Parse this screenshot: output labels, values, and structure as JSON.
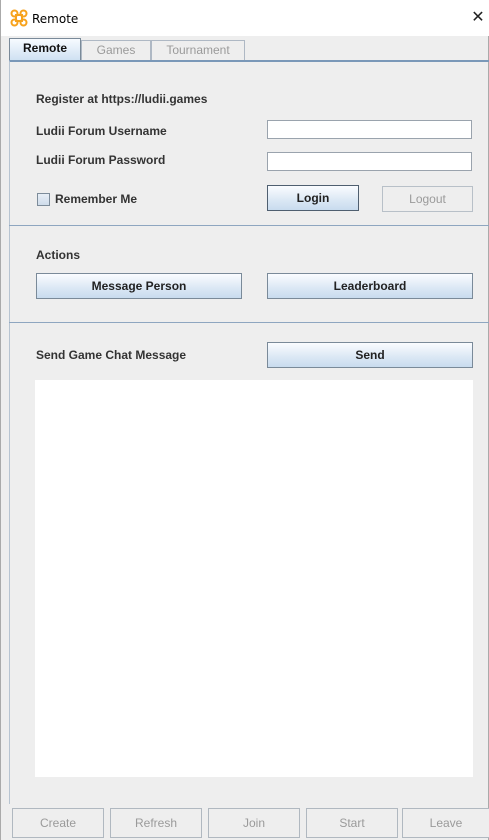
{
  "window": {
    "title": "Remote",
    "close_glyph": "✕"
  },
  "tabs": [
    {
      "label": "Remote",
      "active": true
    },
    {
      "label": "Games",
      "active": false
    },
    {
      "label": "Tournament",
      "active": false
    }
  ],
  "login": {
    "register_text": "Register at https://ludii.games",
    "username_label": "Ludii Forum Username",
    "username_value": "",
    "password_label": "Ludii Forum Password",
    "password_value": "",
    "remember_label": "Remember Me",
    "remember_checked": false,
    "login_button": "Login",
    "logout_button": "Logout"
  },
  "actions": {
    "heading": "Actions",
    "message_button": "Message Person",
    "leaderboard_button": "Leaderboard"
  },
  "chat": {
    "label": "Send Game Chat Message",
    "send_button": "Send",
    "message_text": ""
  },
  "bottom_buttons": [
    "Create",
    "Refresh",
    "Join",
    "Start",
    "Leave"
  ],
  "icons": {
    "app_icon": "ludii-app-icon",
    "close_icon": "close-icon"
  },
  "colors": {
    "accent": "#7a98b8",
    "button_top": "#fafcff",
    "button_bottom": "#c8dbee",
    "app_icon": "#f7a21c"
  }
}
